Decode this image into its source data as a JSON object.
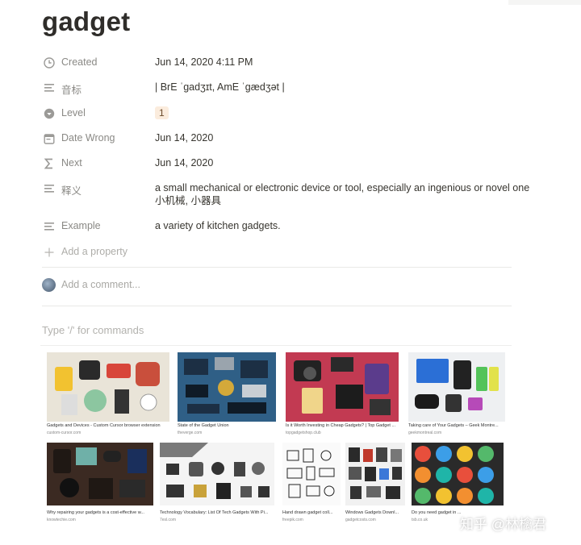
{
  "page": {
    "title": "gadget"
  },
  "properties": [
    {
      "name": "Created",
      "icon": "clock-icon",
      "value": "Jun 14, 2020 4:11 PM"
    },
    {
      "name": "音标",
      "icon": "text-lines-icon",
      "value": "| BrE ˈɡadʒɪt, AmE ˈɡædʒət |"
    },
    {
      "name": "Level",
      "icon": "select-circle-icon",
      "value": "1"
    },
    {
      "name": "Date Wrong",
      "icon": "calendar-icon",
      "value": "Jun 14, 2020"
    },
    {
      "name": "Next",
      "icon": "sigma-icon",
      "value": "Jun 14, 2020"
    },
    {
      "name": "释义",
      "icon": "text-lines-icon",
      "value_line1": "a small mechanical or electronic device or tool, especially an ingenious or novel one",
      "value_line2": "小机械, 小器具"
    },
    {
      "name": "Example",
      "icon": "text-lines-icon",
      "value": "a variety of kitchen gadgets."
    }
  ],
  "add_property_label": "Add a property",
  "comment_placeholder": "Add a comment...",
  "editor_placeholder": "Type '/' for commands",
  "gallery": [
    {
      "caption": "Gadgets and Devices - Custom Cursor browser extension",
      "source": "custom-cursor.com",
      "bg": "#e9e4d8",
      "accent": "#f2c230"
    },
    {
      "caption": "State of the Gadget Union",
      "source": "theverge.com",
      "bg": "#2f5f86",
      "accent": "#1c2f44"
    },
    {
      "caption": "Is it Worth Investing in Cheap Gadgets? | Top Gadget ...",
      "source": "topgadgetshop.club",
      "bg": "#c23a52",
      "accent": "#2a2a2a"
    },
    {
      "caption": "Taking care of Your Gadgets – Geek Montre...",
      "source": "geekmontreal.com",
      "bg": "#eef0f2",
      "accent": "#2b6fd6"
    },
    {
      "caption": "Why repairing your gadgets is a cost-effective w...",
      "source": "knowtechie.com",
      "bg": "#3b2a22",
      "accent": "#1f1814"
    },
    {
      "caption": "Technology Vocabulary: List Of Tech Gadgets With Pi...",
      "source": "7esl.com",
      "bg": "#f4f4f4",
      "accent": "#333333"
    },
    {
      "caption": "Hand drawn gadget coll...",
      "source": "freepik.com",
      "bg": "#fafafa",
      "accent": "#222222"
    },
    {
      "caption": "Windows Gadgets Downl...",
      "source": "gadgetcosts.com",
      "bg": "#f1f1f1",
      "accent": "#2a2a2a"
    },
    {
      "caption": "Do you need gadget in ...",
      "source": "tsb.co.uk",
      "bg": "#2a2a2a",
      "accent": "#e84f3c"
    }
  ],
  "watermark": "知乎 @林檎君",
  "colors": {
    "badge_bg": "#fbecdd",
    "muted_text": "#8a8985",
    "placeholder": "#b3b2ae"
  }
}
